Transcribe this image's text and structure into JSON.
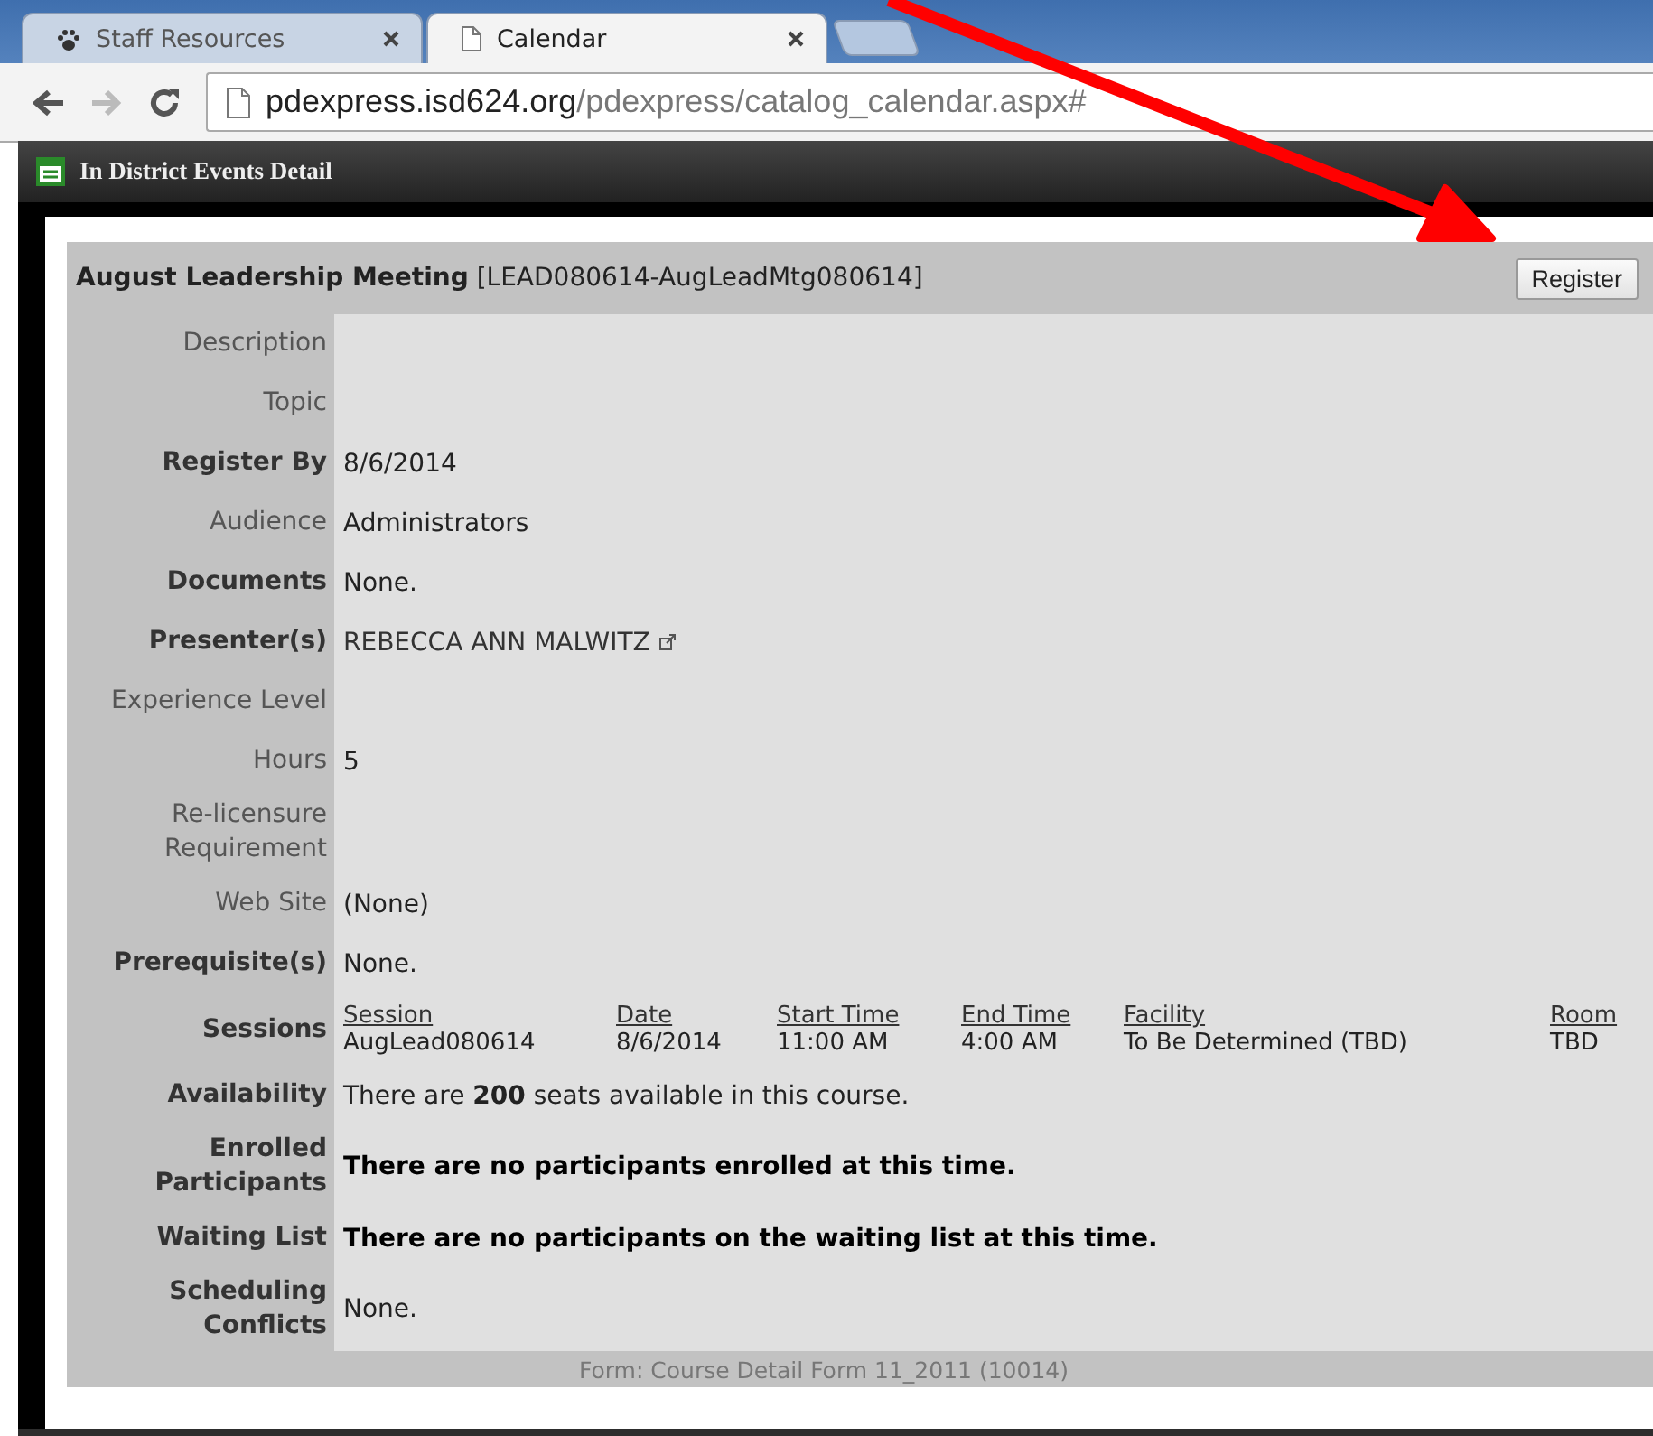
{
  "browser": {
    "tabs": [
      {
        "label": "Staff Resources",
        "selected": false
      },
      {
        "label": "Calendar",
        "selected": true
      }
    ],
    "address": {
      "host": "pdexpress.isd624.org",
      "path": "/pdexpress/catalog_calendar.aspx#"
    }
  },
  "panel": {
    "title": "In District Events Detail"
  },
  "course": {
    "title": "August Leadership Meeting",
    "code": "[LEAD080614-AugLeadMtg080614]",
    "register_button": "Register",
    "fields": [
      {
        "kind": "text",
        "label": "Description",
        "label_bold": false
      },
      {
        "kind": "text",
        "label": "Topic",
        "label_bold": false
      },
      {
        "kind": "text",
        "label": "Register By",
        "label_bold": true,
        "value": "8/6/2014",
        "value_bold": false
      },
      {
        "kind": "text",
        "label": "Audience",
        "label_bold": false,
        "value": "Administrators",
        "value_bold": false
      },
      {
        "kind": "text",
        "label": "Documents",
        "label_bold": true,
        "value": "None.",
        "value_bold": false
      },
      {
        "kind": "link",
        "label": "Presenter(s)",
        "label_bold": true,
        "value": "REBECCA ANN MALWITZ",
        "value_bold": false
      },
      {
        "kind": "text",
        "label": "Experience Level",
        "label_bold": false
      },
      {
        "kind": "text",
        "label": "Hours",
        "label_bold": false,
        "value": "5",
        "value_bold": false
      },
      {
        "kind": "text",
        "label": "Re-licensure Requirement",
        "label_bold": false
      },
      {
        "kind": "text",
        "label": "Web Site",
        "label_bold": false,
        "value": "(None)",
        "value_bold": false
      },
      {
        "kind": "text",
        "label": "Prerequisite(s)",
        "label_bold": true,
        "value": "None.",
        "value_bold": false
      },
      {
        "kind": "sessions",
        "label": "Sessions",
        "label_bold": true,
        "columns": [
          "Session",
          "Date",
          "Start Time",
          "End Time",
          "Facility",
          "Room"
        ],
        "rows": [
          [
            "AugLead080614",
            "8/6/2014",
            "11:00 AM",
            "4:00 AM",
            "To Be Determined (TBD)",
            "TBD"
          ]
        ]
      },
      {
        "kind": "text",
        "label": "Availability",
        "label_bold": true,
        "value": "There are **200** seats available in this course.",
        "value_bold": false
      },
      {
        "kind": "text",
        "label": "Enrolled Participants",
        "label_bold": true,
        "value": "There are no participants enrolled at this time.",
        "value_bold": true
      },
      {
        "kind": "text",
        "label": "Waiting List",
        "label_bold": true,
        "value": "There are no participants on the waiting list at this time.",
        "value_bold": true
      },
      {
        "kind": "text",
        "label": "Scheduling Conflicts",
        "label_bold": true,
        "value": "None.",
        "value_bold": false
      }
    ],
    "footer": "Form: Course Detail Form 11_2011 (10014)"
  }
}
